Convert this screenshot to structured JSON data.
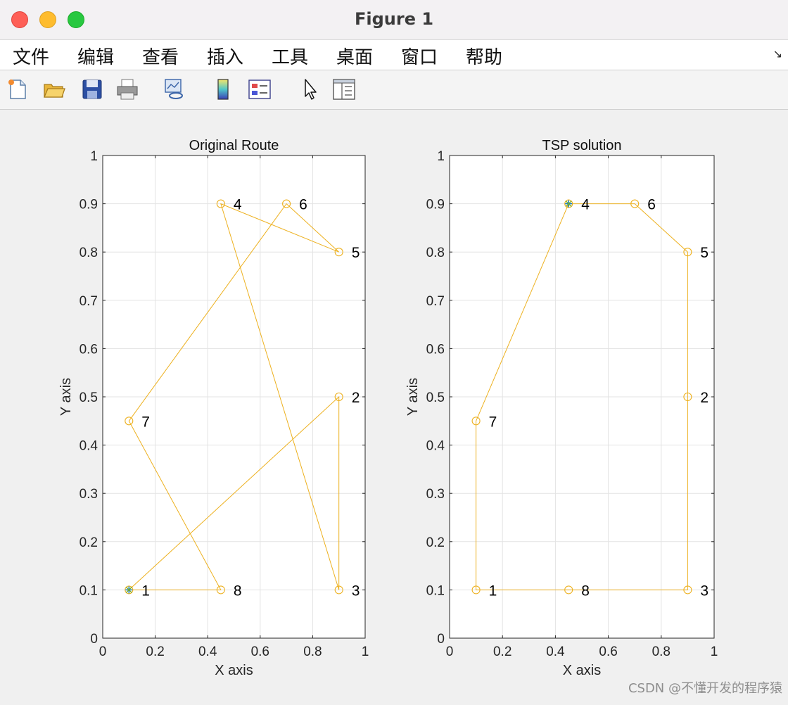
{
  "window": {
    "title": "Figure 1"
  },
  "menu": {
    "items": [
      "文件",
      "编辑",
      "查看",
      "插入",
      "工具",
      "桌面",
      "窗口",
      "帮助"
    ],
    "overflow_icon": "corner-arrow-icon"
  },
  "toolbar": {
    "icons": [
      "new-figure-icon",
      "open-file-icon",
      "save-icon",
      "print-icon",
      "link-plot-icon",
      "colorbar-icon",
      "legend-icon",
      "pointer-icon",
      "property-inspector-icon"
    ]
  },
  "watermark": "CSDN @不懂开发的程序猿",
  "colors": {
    "route": "#edb120",
    "start_marker_a": "#0072bd",
    "start_marker_b": "#77ac30",
    "grid": "#e3e3e3"
  },
  "chart_data": [
    {
      "type": "line",
      "title": "Original Route",
      "xlabel": "X axis",
      "ylabel": "Y axis",
      "xlim": [
        0,
        1
      ],
      "ylim": [
        0,
        1
      ],
      "xticks": [
        0,
        0.2,
        0.4,
        0.6,
        0.8,
        1
      ],
      "xtick_labels": [
        "0",
        "0.2",
        "0.4",
        "0.6",
        "0.8",
        "1"
      ],
      "yticks": [
        0,
        0.1,
        0.2,
        0.3,
        0.4,
        0.5,
        0.6,
        0.7,
        0.8,
        0.9,
        1
      ],
      "ytick_labels": [
        "0",
        "0.1",
        "0.2",
        "0.3",
        "0.4",
        "0.5",
        "0.6",
        "0.7",
        "0.8",
        "0.9",
        "1"
      ],
      "grid": true,
      "points": [
        {
          "label": "1",
          "x": 0.1,
          "y": 0.1
        },
        {
          "label": "2",
          "x": 0.9,
          "y": 0.5
        },
        {
          "label": "3",
          "x": 0.9,
          "y": 0.1
        },
        {
          "label": "4",
          "x": 0.45,
          "y": 0.9
        },
        {
          "label": "5",
          "x": 0.9,
          "y": 0.8
        },
        {
          "label": "6",
          "x": 0.7,
          "y": 0.9
        },
        {
          "label": "7",
          "x": 0.1,
          "y": 0.45
        },
        {
          "label": "8",
          "x": 0.45,
          "y": 0.1
        }
      ],
      "route": [
        "1",
        "2",
        "3",
        "4",
        "5",
        "6",
        "7",
        "8",
        "1"
      ],
      "start": "1"
    },
    {
      "type": "line",
      "title": "TSP solution",
      "xlabel": "X axis",
      "ylabel": "Y axis",
      "xlim": [
        0,
        1
      ],
      "ylim": [
        0,
        1
      ],
      "xticks": [
        0,
        0.2,
        0.4,
        0.6,
        0.8,
        1
      ],
      "xtick_labels": [
        "0",
        "0.2",
        "0.4",
        "0.6",
        "0.8",
        "1"
      ],
      "yticks": [
        0,
        0.1,
        0.2,
        0.3,
        0.4,
        0.5,
        0.6,
        0.7,
        0.8,
        0.9,
        1
      ],
      "ytick_labels": [
        "0",
        "0.1",
        "0.2",
        "0.3",
        "0.4",
        "0.5",
        "0.6",
        "0.7",
        "0.8",
        "0.9",
        "1"
      ],
      "grid": true,
      "points": [
        {
          "label": "1",
          "x": 0.1,
          "y": 0.1
        },
        {
          "label": "2",
          "x": 0.9,
          "y": 0.5
        },
        {
          "label": "3",
          "x": 0.9,
          "y": 0.1
        },
        {
          "label": "4",
          "x": 0.45,
          "y": 0.9
        },
        {
          "label": "5",
          "x": 0.9,
          "y": 0.8
        },
        {
          "label": "6",
          "x": 0.7,
          "y": 0.9
        },
        {
          "label": "7",
          "x": 0.1,
          "y": 0.45
        },
        {
          "label": "8",
          "x": 0.45,
          "y": 0.1
        }
      ],
      "route": [
        "4",
        "6",
        "5",
        "2",
        "3",
        "8",
        "1",
        "7",
        "4"
      ],
      "start": "4"
    }
  ]
}
